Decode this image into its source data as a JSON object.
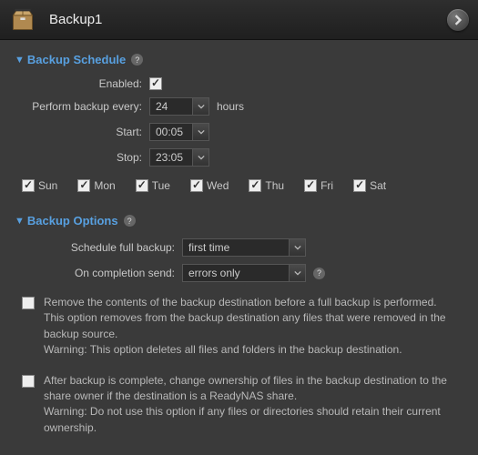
{
  "header": {
    "title": "Backup1"
  },
  "schedule": {
    "section_label": "Backup Schedule",
    "enabled_label": "Enabled:",
    "enabled": true,
    "every_label": "Perform backup every:",
    "every_value": "24",
    "every_suffix": "hours",
    "start_label": "Start:",
    "start_value": "00:05",
    "stop_label": "Stop:",
    "stop_value": "23:05",
    "days": [
      {
        "label": "Sun",
        "checked": true
      },
      {
        "label": "Mon",
        "checked": true
      },
      {
        "label": "Tue",
        "checked": true
      },
      {
        "label": "Wed",
        "checked": true
      },
      {
        "label": "Thu",
        "checked": true
      },
      {
        "label": "Fri",
        "checked": true
      },
      {
        "label": "Sat",
        "checked": true
      }
    ]
  },
  "options": {
    "section_label": "Backup Options",
    "full_label": "Schedule full backup:",
    "full_value": "first time",
    "send_label": "On completion send:",
    "send_value": "errors only",
    "opt_remove": {
      "checked": false,
      "text": "Remove the contents of the backup destination before a full backup is performed. This option removes from the backup destination any files that were removed in the backup source.\nWarning: This option deletes all files and folders in the backup destination."
    },
    "opt_owner": {
      "checked": false,
      "text": "After backup is complete, change ownership of files in the backup destination to the share owner if the destination is a ReadyNAS share.\nWarning: Do not use this option if any files or directories should retain their current ownership."
    }
  }
}
